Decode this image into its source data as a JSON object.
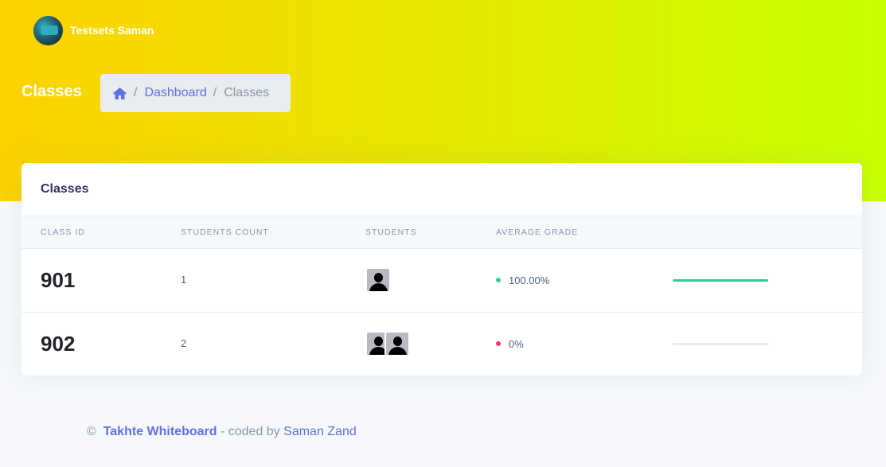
{
  "user": {
    "name": "Testsets Saman"
  },
  "page": {
    "title": "Classes"
  },
  "breadcrumb": {
    "home_icon": "home-icon",
    "items": [
      "Dashboard",
      "Classes"
    ]
  },
  "card": {
    "title": "Classes",
    "columns": [
      "Class ID",
      "Students Count",
      "Students",
      "Average Grade",
      ""
    ],
    "rows": [
      {
        "class_id": "901",
        "students_count": "1",
        "student_avatars": 1,
        "grade": "100.00%",
        "progress": 1.0,
        "status_color": "#2dce89",
        "bar_color": "#2dce89"
      },
      {
        "class_id": "902",
        "students_count": "2",
        "student_avatars": 2,
        "grade": "0%",
        "progress": 0.0,
        "status_color": "#f5365c",
        "bar_color": "#2dce89"
      }
    ]
  },
  "footer": {
    "copyright": "©",
    "brand": "Takhte Whiteboard",
    "middle": "- coded by",
    "author": "Saman Zand"
  },
  "colors": {
    "accent": "#5e72e4",
    "success": "#2dce89",
    "danger": "#f5365c"
  }
}
